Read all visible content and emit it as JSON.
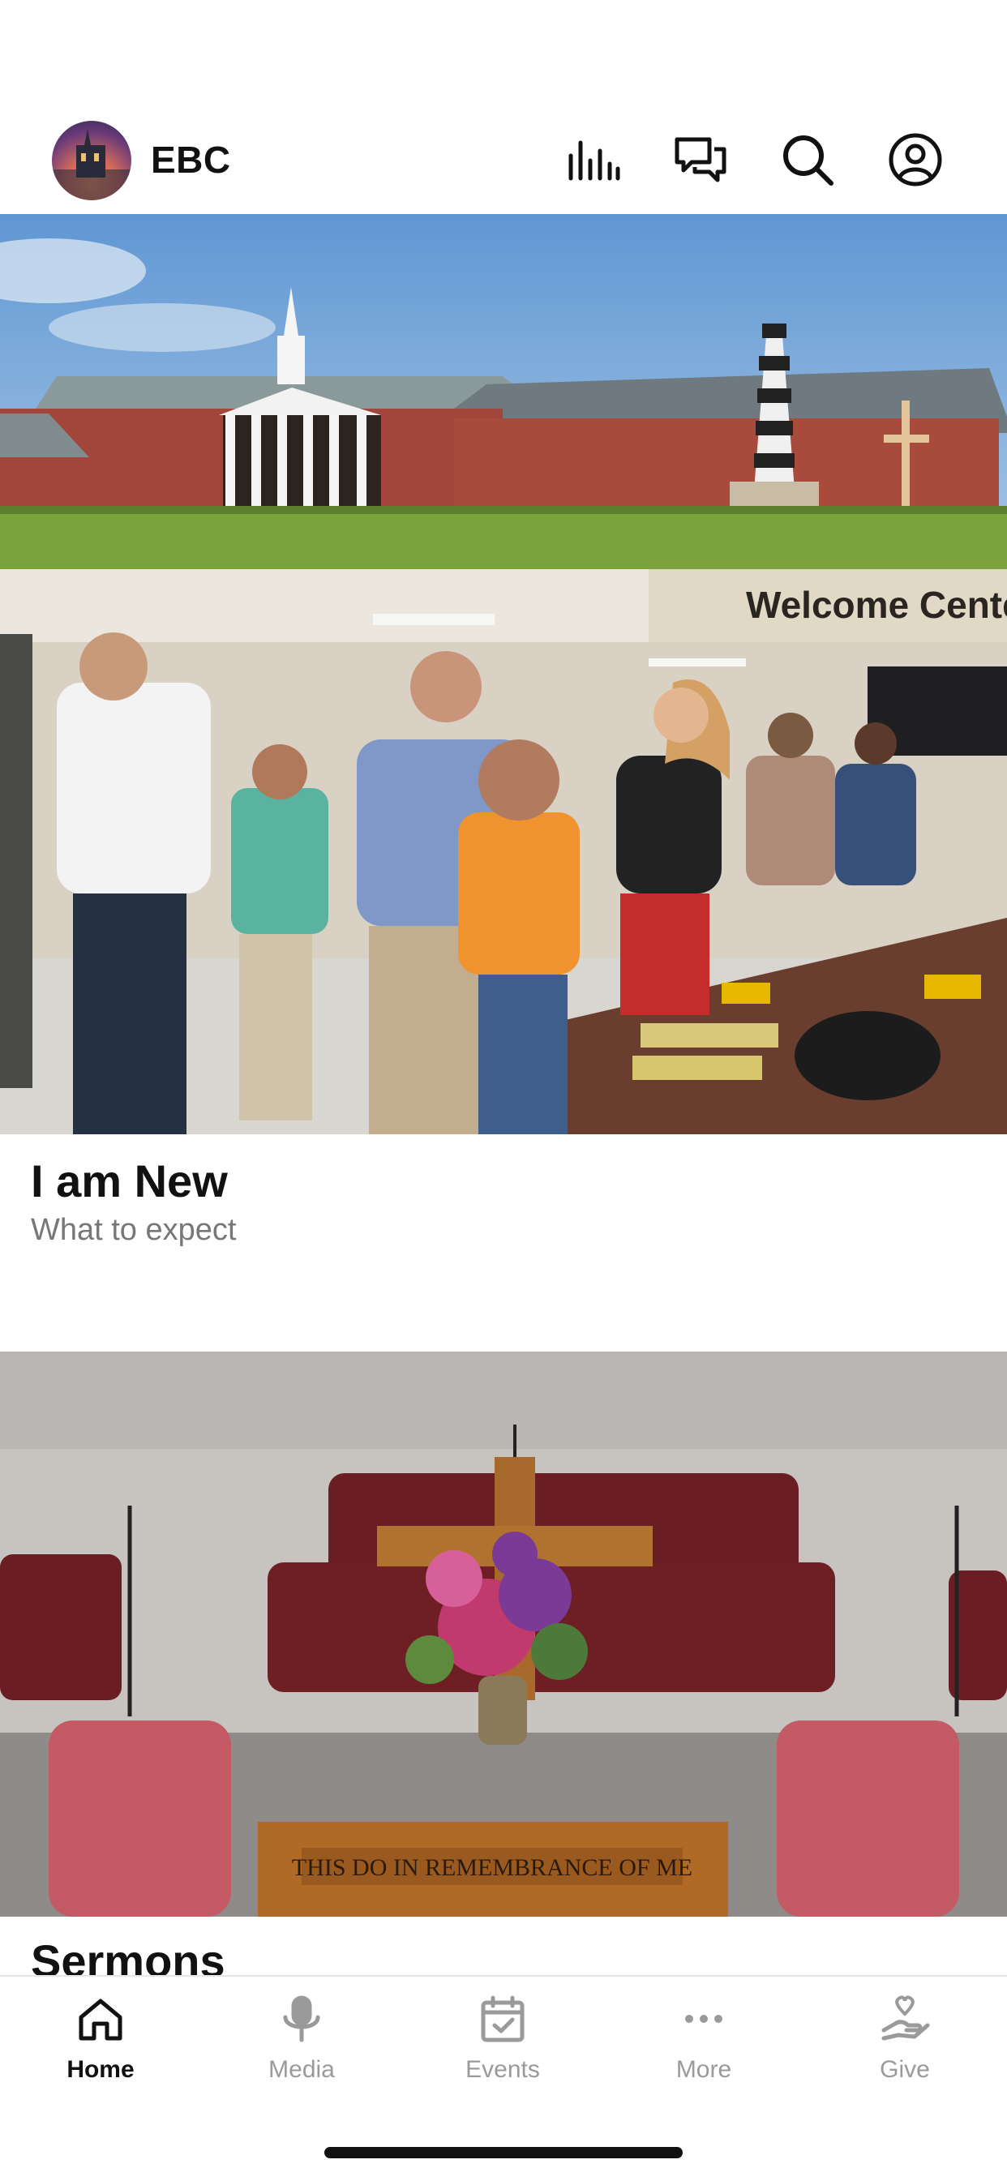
{
  "header": {
    "app_name": "EBC",
    "icons": [
      "audio-bars-icon",
      "chat-icon",
      "search-icon",
      "profile-icon"
    ]
  },
  "cards": [
    {
      "title": "I am New",
      "subtitle": "What to expect",
      "image": "welcome-center-photo"
    },
    {
      "title": "Sermons",
      "image": "sanctuary-altar-photo",
      "altar_inscription": "THIS DO IN REMEMBRANCE OF ME"
    }
  ],
  "hero": {
    "image": "church-building-photo",
    "banner_text": "Welcome Center"
  },
  "tabbar": {
    "tabs": [
      {
        "label": "Home",
        "icon": "home-icon",
        "active": true
      },
      {
        "label": "Media",
        "icon": "microphone-icon",
        "active": false
      },
      {
        "label": "Events",
        "icon": "calendar-icon",
        "active": false
      },
      {
        "label": "More",
        "icon": "more-dots-icon",
        "active": false
      },
      {
        "label": "Give",
        "icon": "give-heart-hand-icon",
        "active": false
      }
    ]
  },
  "colors": {
    "active": "#111111",
    "inactive": "#9a9a9a",
    "background": "#ffffff"
  }
}
